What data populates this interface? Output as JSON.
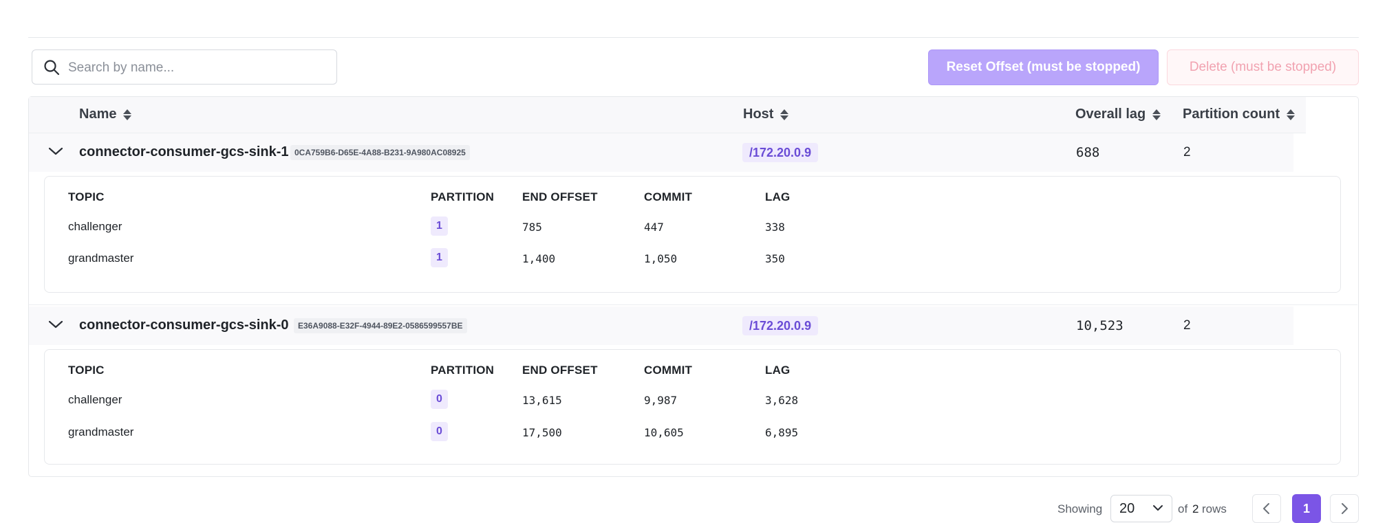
{
  "toolbar": {
    "search_placeholder": "Search by name...",
    "reset_label": "Reset Offset (must be stopped)",
    "delete_label": "Delete (must be stopped)"
  },
  "table": {
    "columns": {
      "name": "Name",
      "host": "Host",
      "overall_lag": "Overall lag",
      "partition_count": "Partition count"
    },
    "sub_columns": {
      "topic": "TOPIC",
      "partition": "PARTITION",
      "end_offset": "END OFFSET",
      "commit": "COMMIT",
      "lag": "LAG"
    },
    "rows": [
      {
        "name": "connector-consumer-gcs-sink-1",
        "id": "0CA759B6-D65E-4A88-B231-9A980AC08925",
        "host": "/172.20.0.9",
        "overall_lag": "688",
        "partition_count": "2",
        "details": [
          {
            "topic": "challenger",
            "partition": "1",
            "end_offset": "785",
            "commit": "447",
            "lag": "338"
          },
          {
            "topic": "grandmaster",
            "partition": "1",
            "end_offset": "1,400",
            "commit": "1,050",
            "lag": "350"
          }
        ]
      },
      {
        "name": "connector-consumer-gcs-sink-0",
        "id": "E36A9088-E32F-4944-89E2-0586599557BE",
        "host": "/172.20.0.9",
        "overall_lag": "10,523",
        "partition_count": "2",
        "details": [
          {
            "topic": "challenger",
            "partition": "0",
            "end_offset": "13,615",
            "commit": "9,987",
            "lag": "3,628"
          },
          {
            "topic": "grandmaster",
            "partition": "0",
            "end_offset": "17,500",
            "commit": "10,605",
            "lag": "6,895"
          }
        ]
      }
    ]
  },
  "pagination": {
    "showing_label": "Showing",
    "page_size": "20",
    "of_label": "of",
    "total": "2",
    "rows_label": "rows",
    "current_page": "1"
  }
}
